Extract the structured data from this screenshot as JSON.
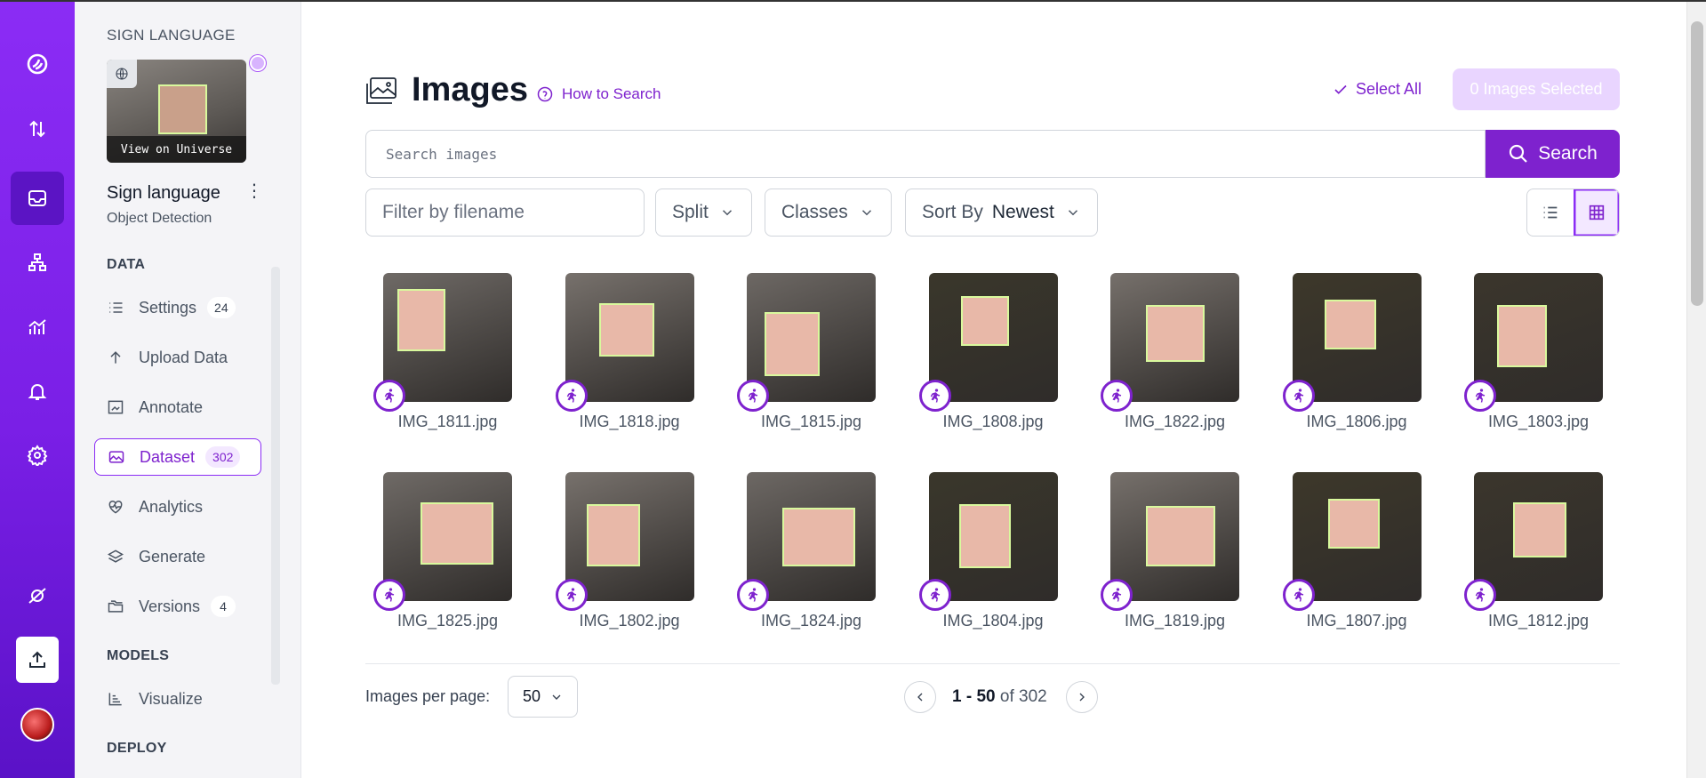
{
  "project": {
    "workspace_label": "SIGN LANGUAGE",
    "thumb_link": "View on Universe",
    "name": "Sign language",
    "type": "Object Detection"
  },
  "sidebar": {
    "sections": {
      "data": "DATA",
      "models": "MODELS",
      "deploy": "DEPLOY"
    },
    "items": [
      {
        "label": "Settings",
        "badge": "24",
        "icon": "list-icon"
      },
      {
        "label": "Upload Data",
        "badge": "",
        "icon": "upload-arrow-icon"
      },
      {
        "label": "Annotate",
        "badge": "",
        "icon": "annotate-icon"
      },
      {
        "label": "Dataset",
        "badge": "302",
        "icon": "image-icon",
        "active": true
      },
      {
        "label": "Analytics",
        "badge": "",
        "icon": "heart-pulse-icon"
      },
      {
        "label": "Generate",
        "badge": "",
        "icon": "layers-icon"
      },
      {
        "label": "Versions",
        "badge": "4",
        "icon": "folders-icon"
      }
    ],
    "models_items": [
      {
        "label": "Visualize",
        "icon": "chart-icon"
      }
    ]
  },
  "header": {
    "title": "Images",
    "how_to": "How to Search",
    "select_all": "Select All",
    "selected_count": "0 Images Selected"
  },
  "search": {
    "placeholder": "Search images",
    "button": "Search"
  },
  "filters": {
    "filename_placeholder": "Filter by filename",
    "split": "Split",
    "classes": "Classes",
    "sort_label": "Sort By",
    "sort_value": "Newest"
  },
  "images": [
    "IMG_1811.jpg",
    "IMG_1818.jpg",
    "IMG_1815.jpg",
    "IMG_1808.jpg",
    "IMG_1822.jpg",
    "IMG_1806.jpg",
    "IMG_1803.jpg",
    "IMG_1825.jpg",
    "IMG_1802.jpg",
    "IMG_1824.jpg",
    "IMG_1804.jpg",
    "IMG_1819.jpg",
    "IMG_1807.jpg",
    "IMG_1812.jpg"
  ],
  "pagination": {
    "per_page_label": "Images per page:",
    "per_page": "50",
    "range": "1 - 50",
    "of_text": "of 302"
  },
  "colors": {
    "accent": "#7e22ce",
    "rail": "#8b2cf5",
    "bbox": "#d9f99d"
  }
}
